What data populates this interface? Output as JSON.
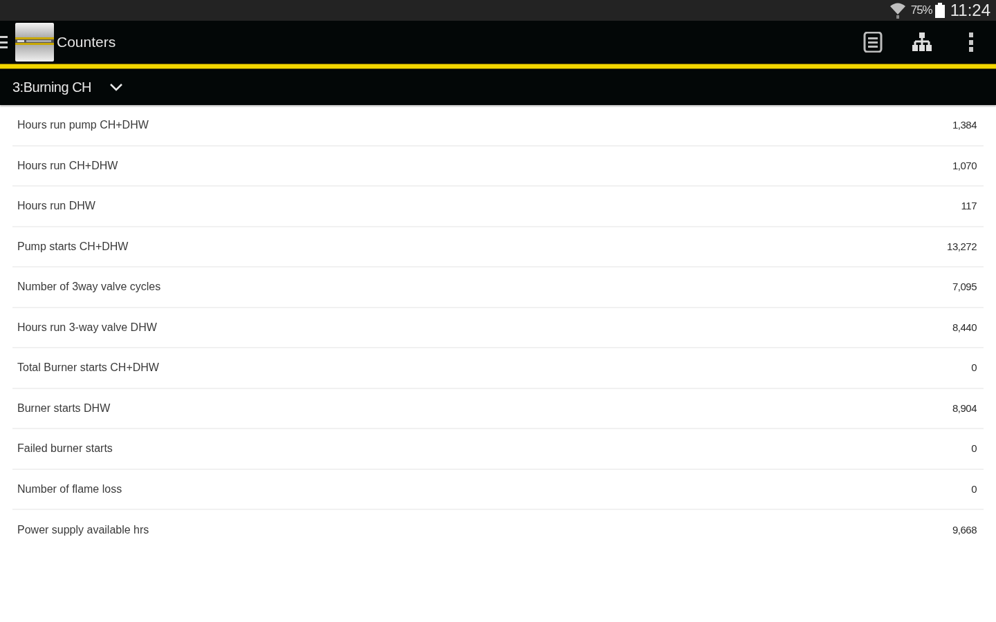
{
  "status_bar": {
    "battery": "75%",
    "time": "11:24"
  },
  "app_bar": {
    "title": "Counters"
  },
  "selector": {
    "value": "3:Burning CH"
  },
  "counters": [
    {
      "label": "Hours run pump CH+DHW",
      "value": "1,384"
    },
    {
      "label": "Hours run CH+DHW",
      "value": "1,070"
    },
    {
      "label": "Hours run DHW",
      "value": "117"
    },
    {
      "label": "Pump starts CH+DHW",
      "value": "13,272"
    },
    {
      "label": "Number of 3way valve cycles",
      "value": "7,095"
    },
    {
      "label": "Hours run 3-way valve DHW",
      "value": "8,440"
    },
    {
      "label": "Total Burner starts CH+DHW",
      "value": "0"
    },
    {
      "label": "Burner starts DHW",
      "value": "8,904"
    },
    {
      "label": "Failed burner starts",
      "value": "0"
    },
    {
      "label": "Number of flame loss",
      "value": "0"
    },
    {
      "label": "Power supply available hrs",
      "value": "9,668"
    }
  ]
}
